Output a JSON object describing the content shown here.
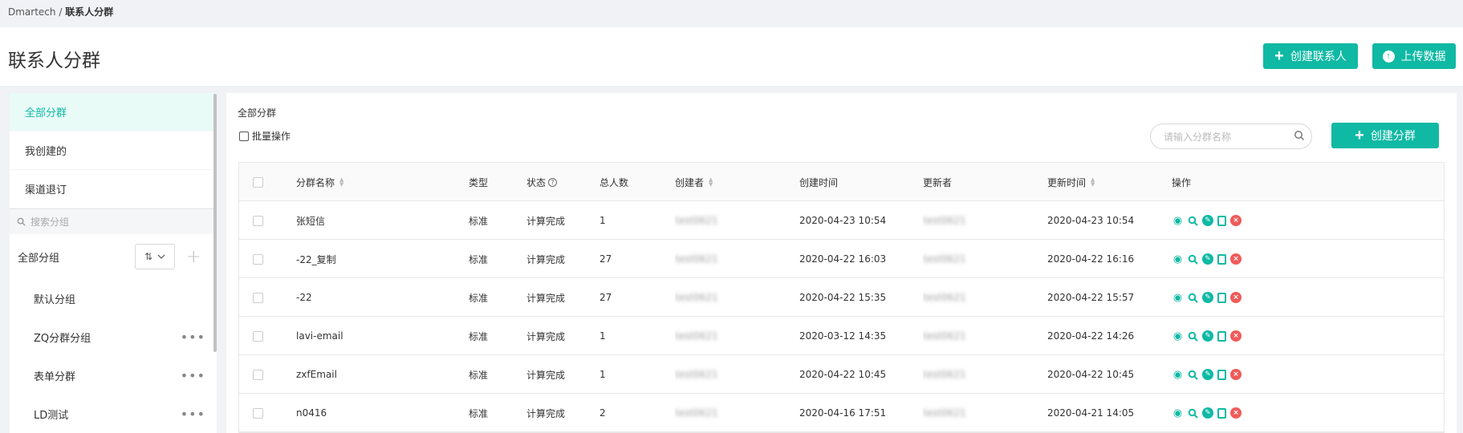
{
  "breadcrumb": {
    "root": "Dmartech",
    "separator": " / ",
    "current": "联系人分群"
  },
  "header": {
    "title": "联系人分群",
    "create_contact_label": "创建联系人",
    "upload_label": "上传数据"
  },
  "sidebar": {
    "nav": [
      {
        "label": "全部分群",
        "active": true
      },
      {
        "label": "我创建的",
        "active": false
      },
      {
        "label": "渠道退订",
        "active": false
      }
    ],
    "search_placeholder": "搜索分组",
    "all_groups_label": "全部分组",
    "sort_label": "⇅",
    "add_symbol": "+",
    "groups": [
      {
        "label": "默认分组",
        "more": false
      },
      {
        "label": "ZQ分群分组",
        "more": true
      },
      {
        "label": "表单分群",
        "more": true
      },
      {
        "label": "LD测试",
        "more": true
      }
    ]
  },
  "main": {
    "title": "全部分群",
    "batch_label": "批量操作",
    "search_placeholder": "请输入分群名称",
    "create_group_label": "创建分群",
    "columns": {
      "name": "分群名称",
      "type": "类型",
      "status": "状态",
      "total": "总人数",
      "creator": "创建者",
      "created_at": "创建时间",
      "updater": "更新者",
      "updated_at": "更新时间",
      "actions": "操作"
    },
    "rows": [
      {
        "name": "张短信",
        "type": "标准",
        "status": "计算完成",
        "total": "1",
        "creator": "test0621",
        "created_at": "2020-04-23 10:54",
        "updater": "test0621",
        "updated_at": "2020-04-23 10:54"
      },
      {
        "name": "-22_复制",
        "type": "标准",
        "status": "计算完成",
        "total": "27",
        "creator": "test0621",
        "created_at": "2020-04-22 16:03",
        "updater": "test0621",
        "updated_at": "2020-04-22 16:16"
      },
      {
        "name": "-22",
        "type": "标准",
        "status": "计算完成",
        "total": "27",
        "creator": "test0621",
        "created_at": "2020-04-22 15:35",
        "updater": "test0621",
        "updated_at": "2020-04-22 15:57"
      },
      {
        "name": "lavi-email",
        "type": "标准",
        "status": "计算完成",
        "total": "1",
        "creator": "test0621",
        "created_at": "2020-03-12 14:35",
        "updater": "test0621",
        "updated_at": "2020-04-22 14:26"
      },
      {
        "name": "zxfEmail",
        "type": "标准",
        "status": "计算完成",
        "total": "1",
        "creator": "test0621",
        "created_at": "2020-04-22 10:45",
        "updater": "test0621",
        "updated_at": "2020-04-22 10:45"
      },
      {
        "name": "n0416",
        "type": "标准",
        "status": "计算完成",
        "total": "2",
        "creator": "test0621",
        "created_at": "2020-04-16 17:51",
        "updater": "test0621",
        "updated_at": "2020-04-21 14:05"
      }
    ]
  },
  "colors": {
    "accent": "#0fb9a4",
    "danger": "#f05a5a",
    "active_bg": "#e8fbf7"
  }
}
